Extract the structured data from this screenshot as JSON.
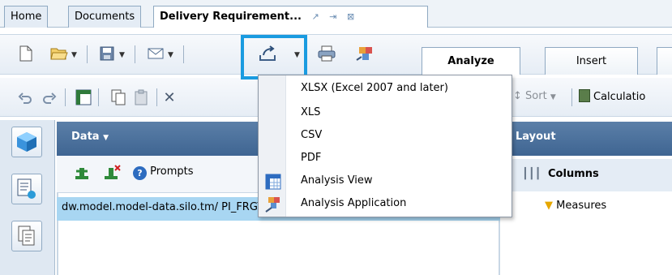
{
  "tabs": [
    {
      "label": "Home"
    },
    {
      "label": "Documents"
    },
    {
      "label": "Delivery Requirement..."
    }
  ],
  "ribbon_tabs": [
    {
      "label": "Analyze"
    },
    {
      "label": "Insert"
    }
  ],
  "toolbar2": {
    "sort_label": "Sort",
    "calculation_label": "Calculatio"
  },
  "data_panel": {
    "title": "Data",
    "prompts_label": "Prompts",
    "source_row": "dw.model.model-data.silo.tm/ PI_FRGT_DRP_PRG [Allia"
  },
  "layout_panel": {
    "title": "Layout",
    "columns_label": "Columns",
    "measures_label": "Measures"
  },
  "export_menu": {
    "items": [
      {
        "label": "XLSX (Excel 2007 and later)"
      },
      {
        "label": "XLS"
      },
      {
        "label": "CSV"
      },
      {
        "label": "PDF"
      },
      {
        "label": "Analysis View"
      },
      {
        "label": "Analysis Application"
      }
    ]
  },
  "colors": {
    "highlight_border": "#1a9be0",
    "panel_header": "#4b7099",
    "selected_row": "#a8d6f2"
  }
}
